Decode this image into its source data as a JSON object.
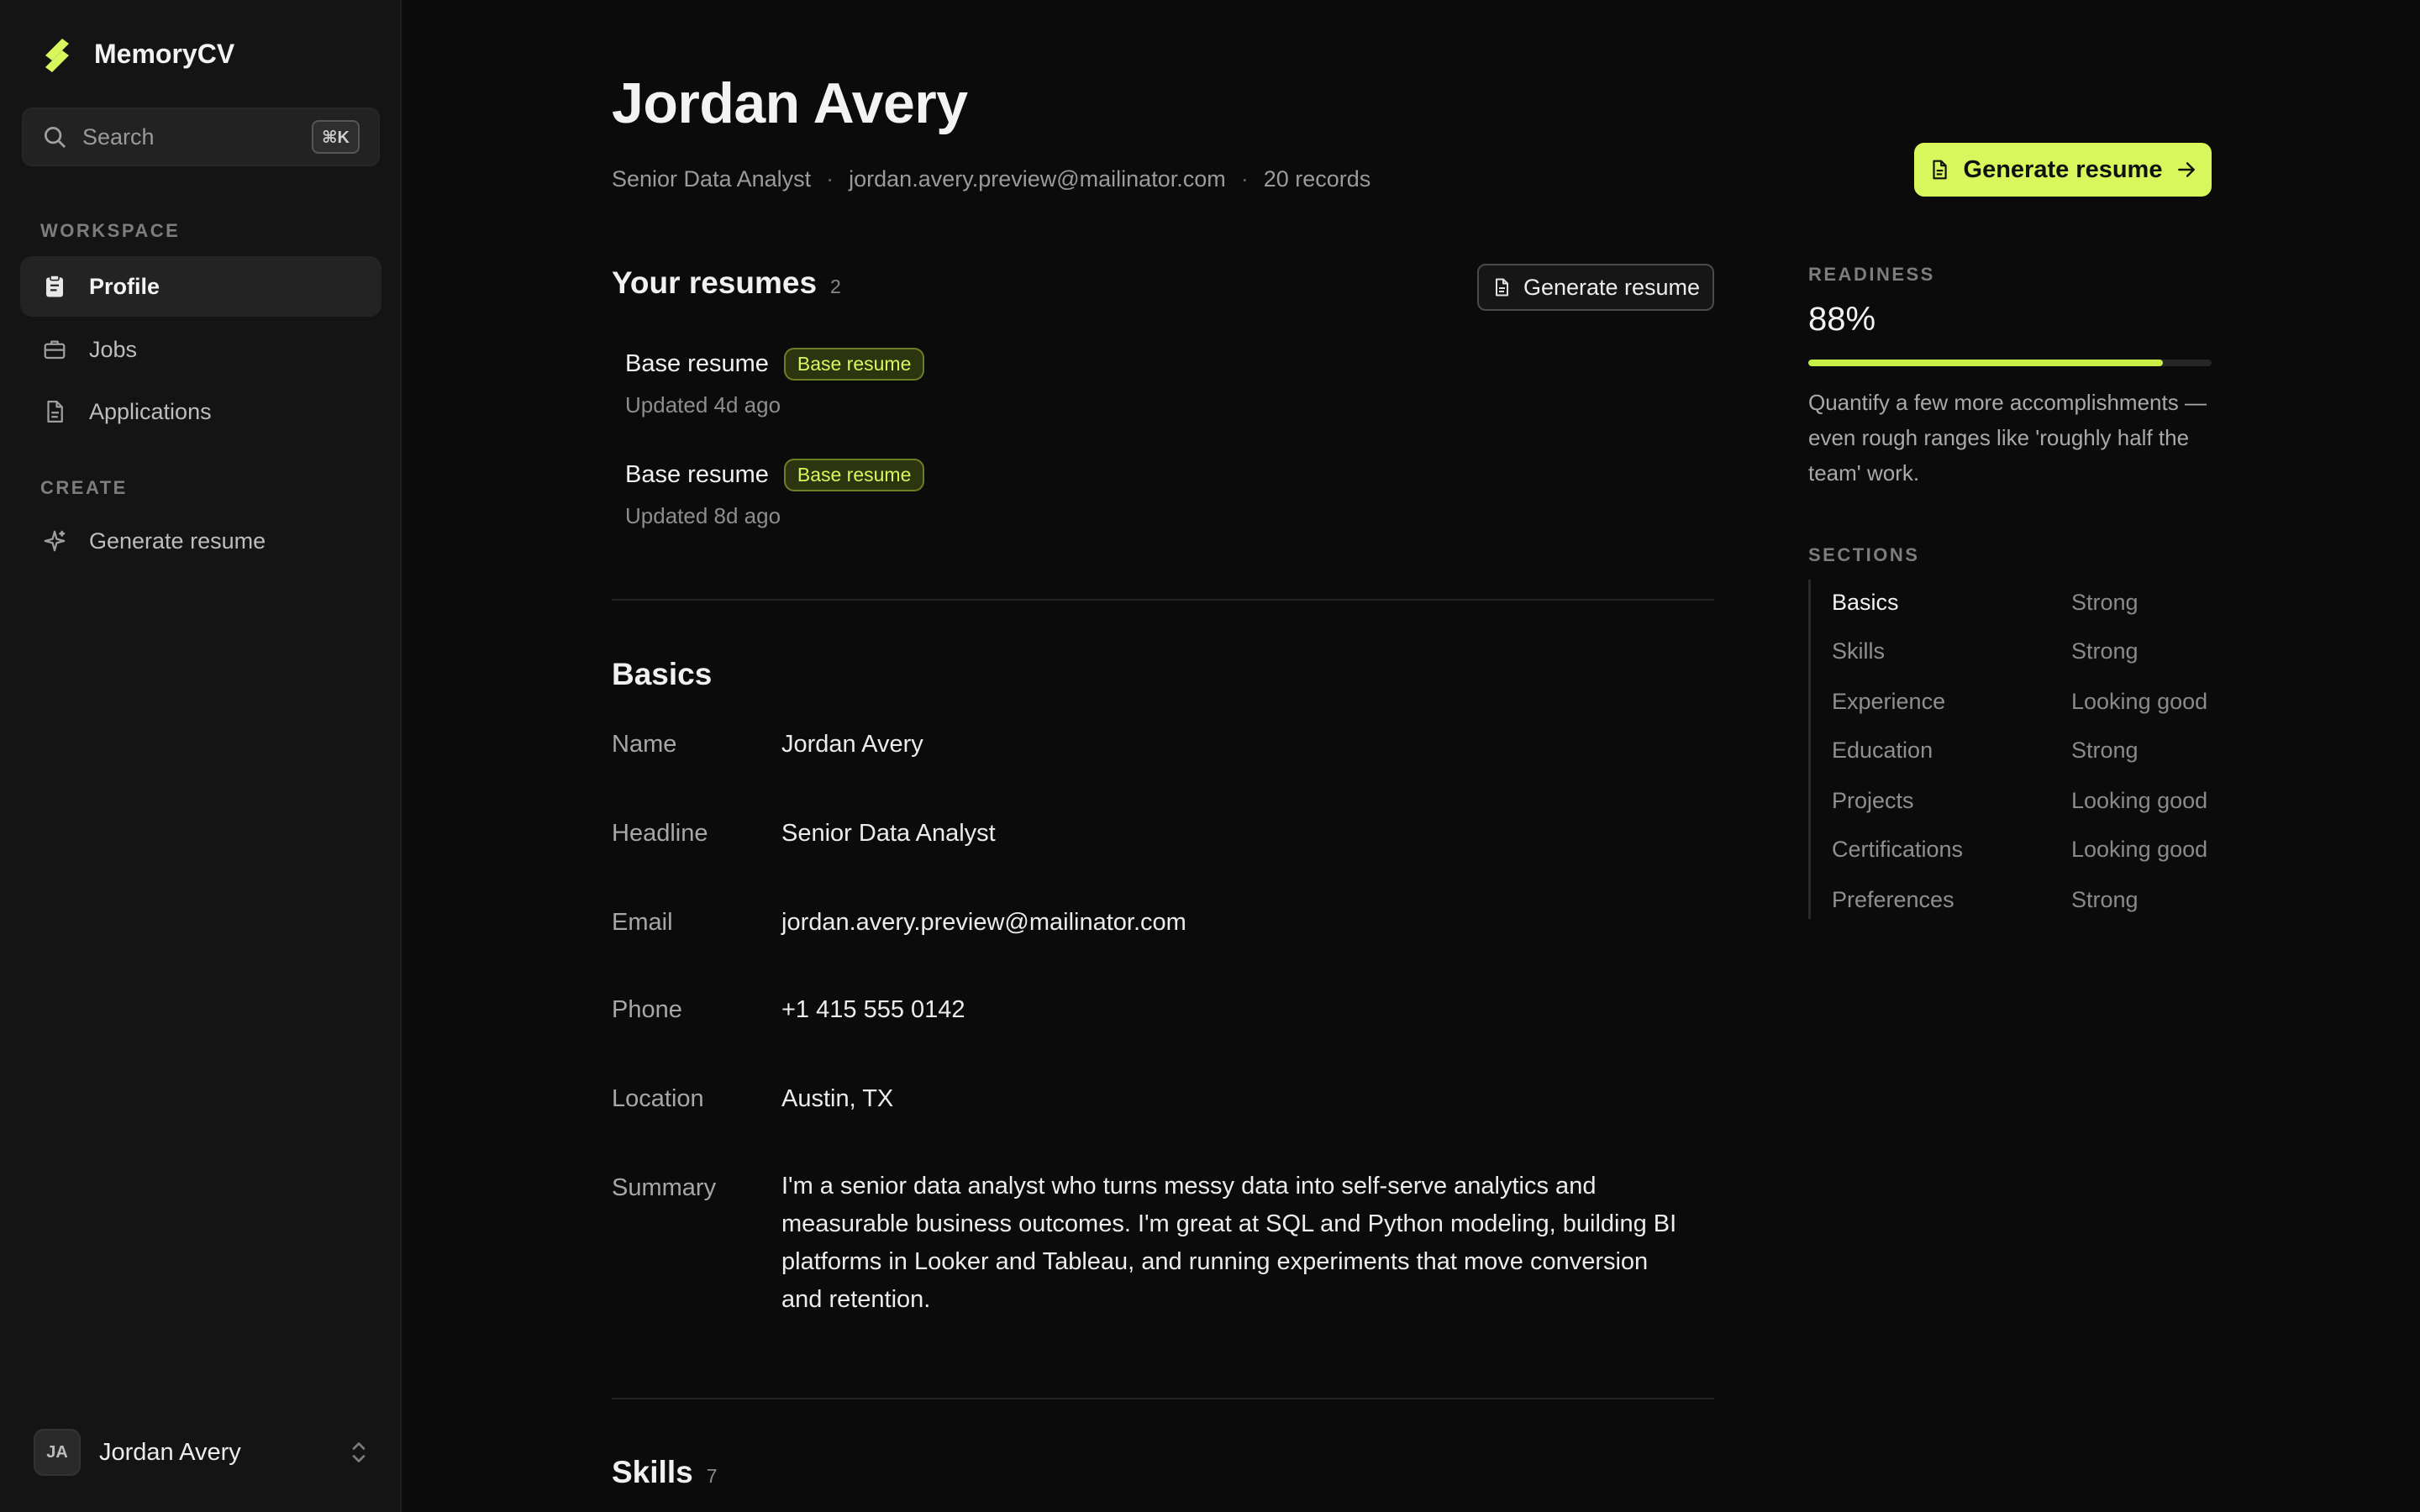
{
  "brand": {
    "name": "MemoryCV",
    "accent": "#d7f75c"
  },
  "search": {
    "label": "Search",
    "shortcut": "⌘K"
  },
  "sidebar": {
    "workspace_label": "WORKSPACE",
    "create_label": "CREATE",
    "items": [
      {
        "label": "Profile",
        "icon": "clipboard-icon",
        "active": true
      },
      {
        "label": "Jobs",
        "icon": "briefcase-icon"
      },
      {
        "label": "Applications",
        "icon": "document-icon"
      }
    ],
    "create_items": [
      {
        "label": "Generate resume",
        "icon": "sparkle-icon"
      }
    ],
    "user": {
      "initials": "JA",
      "name": "Jordan Avery"
    }
  },
  "header": {
    "name": "Jordan Avery",
    "headline": "Senior Data Analyst",
    "email": "jordan.avery.preview@mailinator.com",
    "records": "20 records",
    "separator": "·",
    "primary_button": "Generate resume"
  },
  "resumes": {
    "title": "Your resumes",
    "count": "2",
    "button": "Generate resume",
    "items": [
      {
        "name": "Base resume",
        "badge": "Base resume",
        "updated": "Updated 4d ago"
      },
      {
        "name": "Base resume",
        "badge": "Base resume",
        "updated": "Updated 8d ago"
      }
    ]
  },
  "basics": {
    "title": "Basics",
    "fields": [
      {
        "label": "Name",
        "value": "Jordan Avery"
      },
      {
        "label": "Headline",
        "value": "Senior Data Analyst"
      },
      {
        "label": "Email",
        "value": "jordan.avery.preview@mailinator.com"
      },
      {
        "label": "Phone",
        "value": "+1 415 555 0142"
      },
      {
        "label": "Location",
        "value": "Austin, TX"
      },
      {
        "label": "Summary",
        "value": "I'm a senior data analyst who turns messy data into self-serve analytics and measurable business outcomes. I'm great at SQL and Python modeling, building BI platforms in Looker and Tableau, and running experiments that move conversion and retention."
      }
    ]
  },
  "skills": {
    "title": "Skills",
    "count": "7"
  },
  "readiness": {
    "label": "READINESS",
    "value": "88%",
    "fraction": 0.88,
    "note": "Quantify a few more accomplishments — even rough ranges like 'roughly half the team' work."
  },
  "sections": {
    "label": "SECTIONS",
    "items": [
      {
        "name": "Basics",
        "status": "Strong",
        "active": true
      },
      {
        "name": "Skills",
        "status": "Strong"
      },
      {
        "name": "Experience",
        "status": "Looking good"
      },
      {
        "name": "Education",
        "status": "Strong"
      },
      {
        "name": "Projects",
        "status": "Looking good"
      },
      {
        "name": "Certifications",
        "status": "Looking good"
      },
      {
        "name": "Preferences",
        "status": "Strong"
      }
    ]
  }
}
